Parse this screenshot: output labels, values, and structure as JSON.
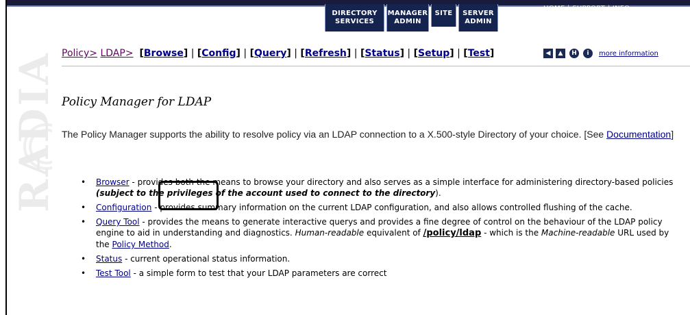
{
  "tabs": [
    {
      "line1": "DIRECTORY",
      "line2": "SERVICES"
    },
    {
      "line1": "MANAGER",
      "line2": "ADMIN"
    },
    {
      "line1": "SITE",
      "line2": ""
    },
    {
      "line1": "SERVER",
      "line2": "ADMIN"
    }
  ],
  "toplinks": {
    "home": "HOME",
    "sep1": " | ",
    "support": "SUPPORT",
    "sep2": " | ",
    "info": "INFO"
  },
  "watermark": "RADIA",
  "nav": {
    "crumb1": "Policy>",
    "crumb2": "LDAP>",
    "links": [
      "Browse",
      "Config",
      "Query",
      "Refresh",
      "Status",
      "Setup",
      "Test"
    ],
    "more_info": "more information"
  },
  "icons": [
    "back-icon",
    "up-icon",
    "help-icon",
    "info-icon"
  ],
  "title": "Policy Manager for LDAP",
  "intro": {
    "text": "The Policy Manager supports the ability to resolve policy via an LDAP connection to a X.500-style Directory of your choice. [See ",
    "link": "Documentation",
    "end": "]"
  },
  "items": [
    {
      "link": "Browser",
      "t1": " - provides both the means to browse your directory and also serves as a simple interface for administering directory-based policies ",
      "bold": "(subject to the privileges of the account used to connect to the directory",
      "t2": ")."
    },
    {
      "link": "Configuration",
      "t1": " - provides summary information on the current LDAP configuration, and also allows controlled flushing of the cache."
    },
    {
      "link": "Query Tool",
      "t1": " - provides the means to generate interactive querys and provides a fine degree of control on the behaviour of the LDAP policy engine to aid in understanding and diagnostics. ",
      "em1": "Human-readable",
      "t2": " equivalent of ",
      "path": "/policy/ldap",
      "t3": " - which is the ",
      "em2": "Machine-readable",
      "t4": " URL used by the ",
      "link2": "Policy Method",
      "t5": "."
    },
    {
      "link": "Status",
      "t1": " - current operational status information."
    },
    {
      "link": "Test Tool",
      "t1": " - a simple form to test that your LDAP parameters are correct"
    }
  ],
  "colors": {
    "nav_bg": "#14244e",
    "link": "#000088",
    "crumb": "#5a0a5a"
  }
}
